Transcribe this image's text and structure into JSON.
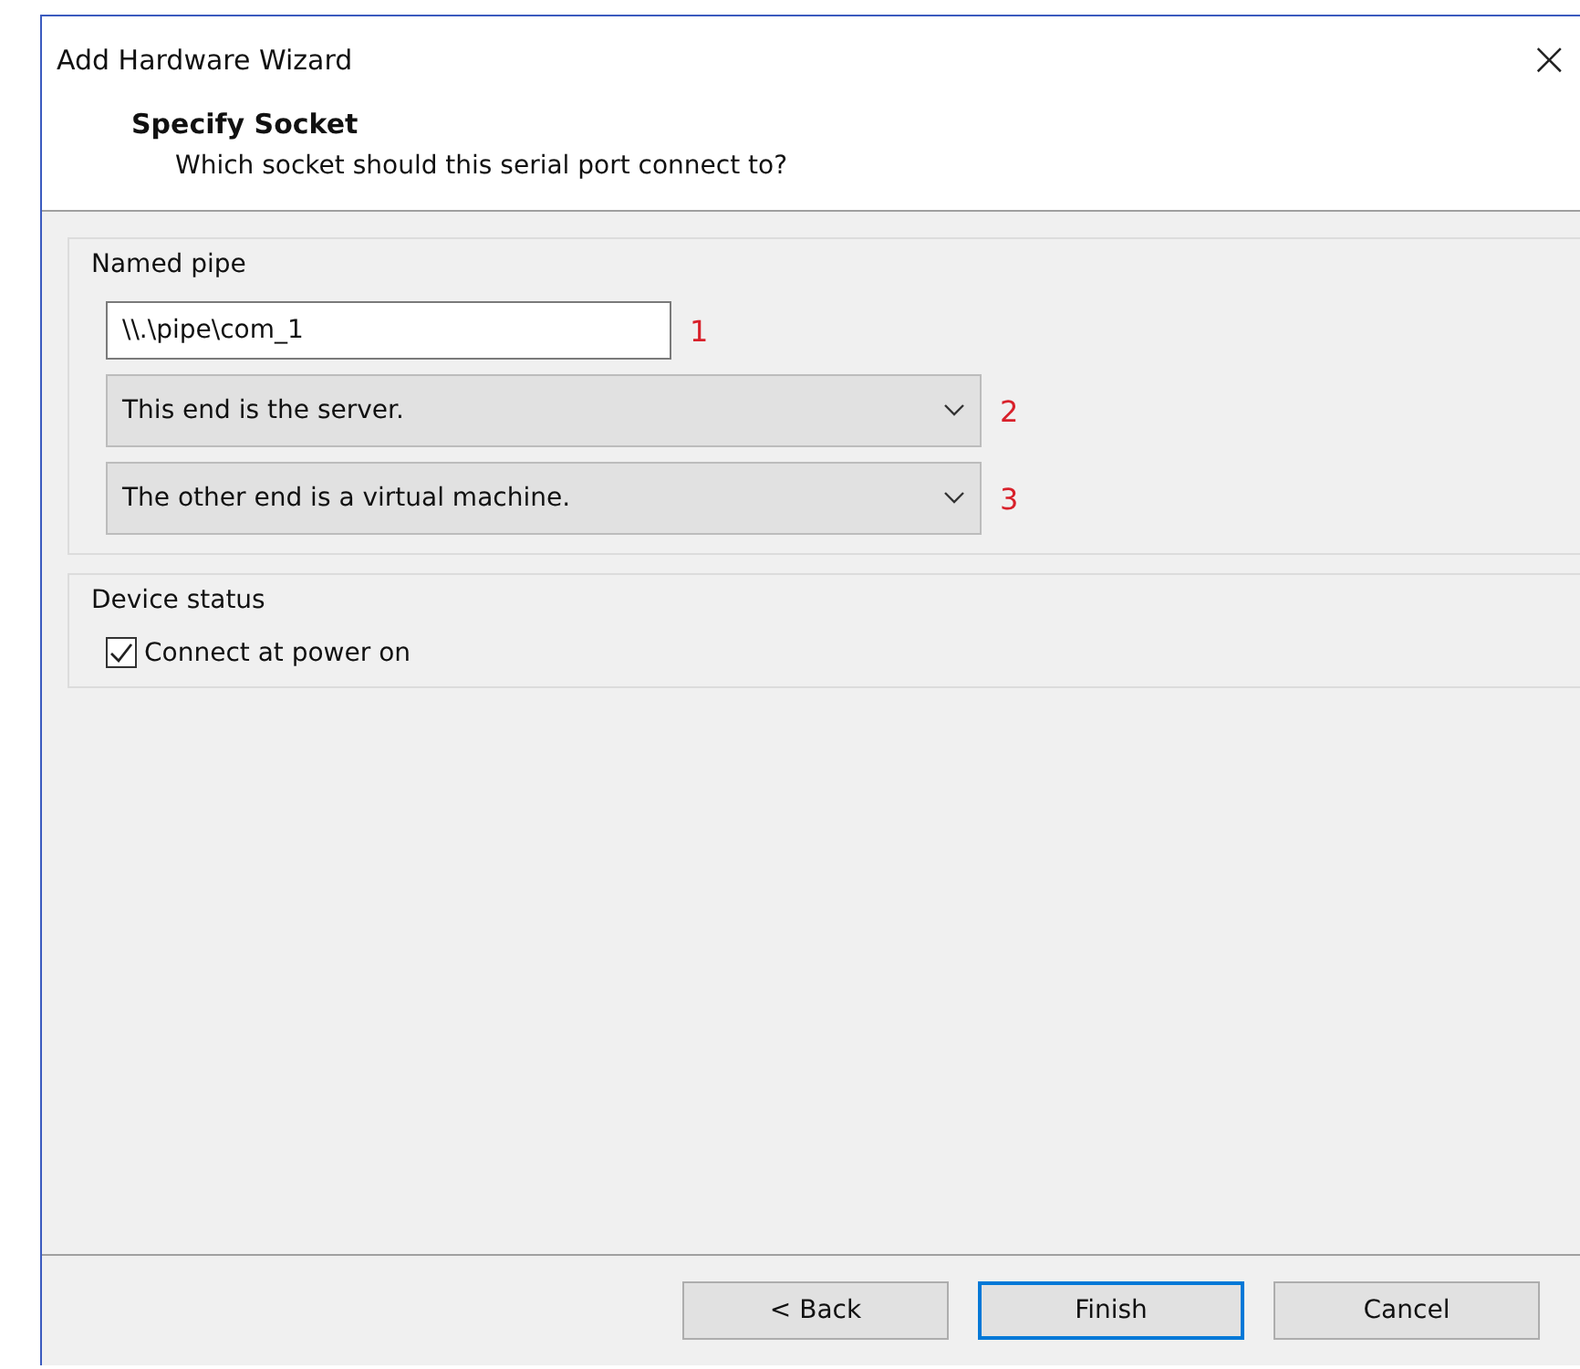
{
  "window": {
    "title": "Add Hardware Wizard",
    "close": "×"
  },
  "header": {
    "title": "Specify Socket",
    "subtitle": "Which socket should this serial port connect to?"
  },
  "named_pipe": {
    "label": "Named pipe",
    "path": {
      "value": "\\\\.\\pipe\\com_1",
      "marker": "1"
    },
    "dropdowns": [
      {
        "value": "This end is the server.",
        "marker": "2"
      },
      {
        "value": "The other end is a virtual machine.",
        "marker": "3"
      }
    ]
  },
  "device_status": {
    "label": "Device status",
    "checkbox": {
      "label": "Connect at power on",
      "checked": true
    }
  },
  "buttons": [
    {
      "label": "< Back",
      "default": false
    },
    {
      "label": "Finish",
      "default": true
    },
    {
      "label": "Cancel",
      "default": false
    }
  ]
}
